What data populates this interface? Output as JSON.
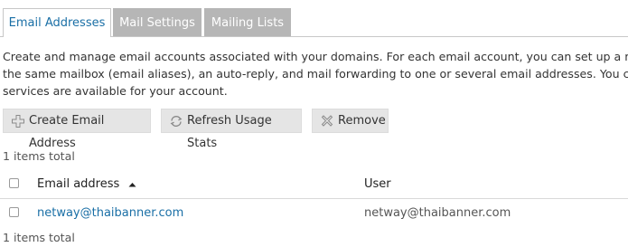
{
  "tabs": [
    {
      "label": "Email Addresses",
      "active": true
    },
    {
      "label": "Mail Settings",
      "active": false
    },
    {
      "label": "Mailing Lists",
      "active": false
    }
  ],
  "description": {
    "line1": "Create and manage email accounts associated with your domains. For each email account, you can set up a mailbo",
    "line2": "the same mailbox (email aliases), an auto-reply, and mail forwarding to one or several email addresses. You can als",
    "line3": "services are available for your account."
  },
  "toolbar": {
    "create_label": "Create Email Address",
    "refresh_label": "Refresh Usage Stats",
    "remove_label": "Remove"
  },
  "items_total": "1 items total",
  "table": {
    "columns": [
      "Email address",
      "User"
    ],
    "sort": "ascending",
    "rows": [
      {
        "email": "netway@thaibanner.com",
        "user": "netway@thaibanner.com"
      }
    ]
  },
  "colors": {
    "accent": "#1a6fa6",
    "tab_inactive": "#b6b6b6",
    "button_bg": "#e5e5e5"
  },
  "icons": {
    "create": "plus-icon",
    "refresh": "refresh-icon",
    "remove": "x-icon",
    "sort": "caret-up-icon"
  }
}
